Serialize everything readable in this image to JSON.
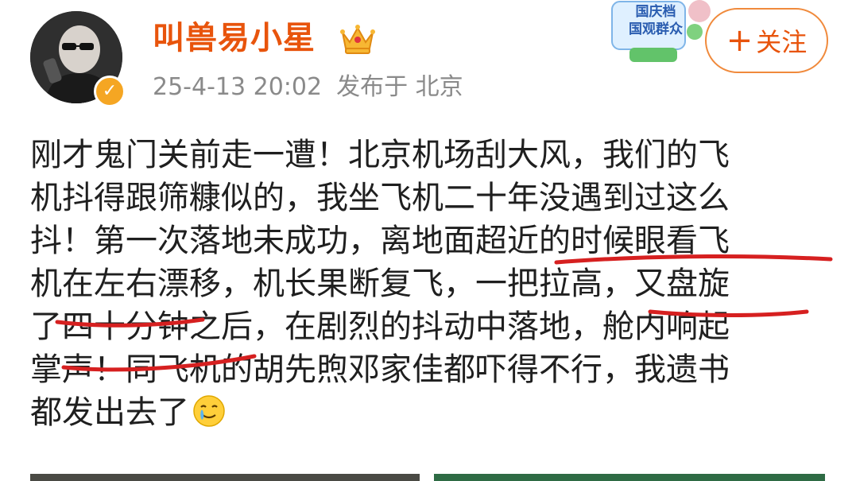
{
  "post": {
    "username": "叫兽易小星",
    "timestamp": "25-4-13 20:02",
    "location": "发布于 北京",
    "follow_plus": "+",
    "follow_label": "关注",
    "promo_line1": "国庆档",
    "promo_line2": "国观群众",
    "lines": [
      "刚才鬼门关前走一遭！北京机场刮大风，我们的飞",
      "机抖得跟筛糠似的，我坐飞机二十年没遇到过这么",
      "抖！第一次落地未成功，离地面超近的时候眼看飞",
      "机在左右漂移，机长果断复飞，一把拉高，又盘旋",
      "了四十分钟之后，在剧烈的抖动中落地，舱内响起",
      "掌声！同飞机的胡先煦邓家佳都吓得不行，我遗书",
      "都发出去了"
    ]
  },
  "colors": {
    "username": "#e8540c",
    "meta": "#8a8a8a",
    "follow_border": "#f08a3c",
    "verified": "#f5a623",
    "underline": "#d62020"
  },
  "icons": [
    "crown-icon",
    "verified-icon",
    "crying-laughing-emoji-icon"
  ]
}
